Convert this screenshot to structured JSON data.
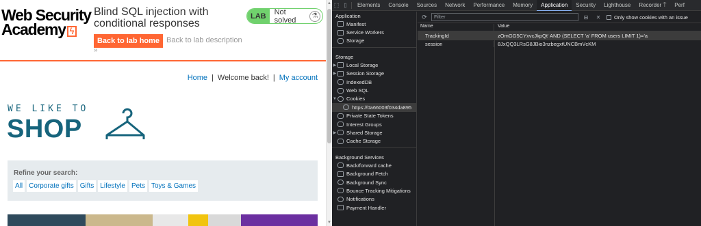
{
  "page": {
    "logo_line1": "Web Security",
    "logo_line2": "Academy",
    "logo_mark": "ϟ",
    "lab_title": "Blind SQL injection with conditional responses",
    "lab_badge": "LAB",
    "lab_status": "Not solved",
    "flask_icon": "⚗",
    "back_home": "Back to lab home",
    "back_description": "Back to lab description",
    "chevron": "»",
    "nav": {
      "home": "Home",
      "sep1": "|",
      "welcome": "Welcome back!",
      "sep2": "|",
      "account": "My account"
    },
    "tagline": "WE LIKE TO",
    "shop": "SHOP",
    "refine_title": "Refine your search:",
    "filters": [
      "All",
      "Corporate gifts",
      "Gifts",
      "Lifestyle",
      "Pets",
      "Toys & Games"
    ],
    "accent_color": "#ff6633",
    "brand_color": "#16647c"
  },
  "devtools": {
    "tabs": [
      "Elements",
      "Console",
      "Sources",
      "Network",
      "Performance",
      "Memory",
      "Application",
      "Security",
      "Lighthouse",
      "Recorder ⍑",
      "Perf"
    ],
    "active_tab": "Application",
    "sections": {
      "application": "Application",
      "application_items": [
        "Manifest",
        "Service Workers",
        "Storage"
      ],
      "storage": "Storage",
      "storage_items": [
        "Local Storage",
        "Session Storage",
        "IndexedDB",
        "Web SQL",
        "Cookies"
      ],
      "cookie_origin": "https://0a66003f034da895",
      "storage_items_after": [
        "Private State Tokens",
        "Interest Groups",
        "Shared Storage",
        "Cache Storage"
      ],
      "background": "Background Services",
      "background_items": [
        "Back/forward cache",
        "Background Fetch",
        "Background Sync",
        "Bounce Tracking Mitigations",
        "Notifications",
        "Payment Handler"
      ]
    },
    "filter_placeholder": "Filter",
    "only_issue_label": "Only show cookies with an issue",
    "columns": {
      "name": "Name",
      "value": "Value"
    },
    "cookies": [
      {
        "name": "TrackingId",
        "value": "zOmGG5CYxvcJkpQt' AND (SELECT 'a' FROM users LIMIT 1)='a"
      },
      {
        "name": "session",
        "value": "8JxQQ3LRsG8JBio3nzbegxtUNCBmVcKM"
      }
    ]
  }
}
